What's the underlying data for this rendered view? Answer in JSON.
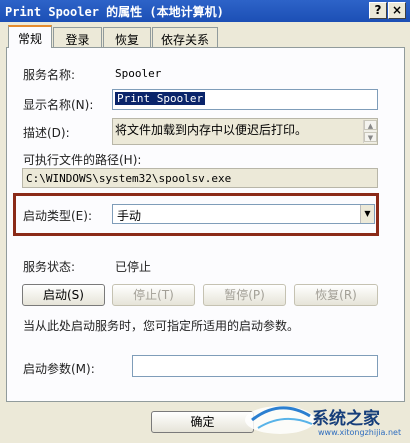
{
  "window": {
    "title": "Print Spooler 的属性 (本地计算机)",
    "help_button": "?",
    "close_button": "×"
  },
  "tabs": [
    {
      "label": "常规",
      "active": true
    },
    {
      "label": "登录",
      "active": false
    },
    {
      "label": "恢复",
      "active": false
    },
    {
      "label": "依存关系",
      "active": false
    }
  ],
  "general": {
    "service_name_label": "服务名称:",
    "service_name_value": "Spooler",
    "display_name_label": "显示名称(N):",
    "display_name_value": "Print Spooler",
    "description_label": "描述(D):",
    "description_value": "将文件加载到内存中以便迟后打印。",
    "path_label": "可执行文件的路径(H):",
    "path_value": "C:\\WINDOWS\\system32\\spoolsv.exe",
    "startup_type_label": "启动类型(E):",
    "startup_type_value": "手动",
    "status_label": "服务状态:",
    "status_value": "已停止",
    "buttons": {
      "start": "启动(S)",
      "stop": "停止(T)",
      "pause": "暂停(P)",
      "resume": "恢复(R)"
    },
    "hint_text": "当从此处启动服务时，您可指定所适用的启动参数。",
    "start_params_label": "启动参数(M):",
    "start_params_value": ""
  },
  "footer": {
    "ok_label": "确定"
  },
  "watermark": {
    "text": "系统之家",
    "url_text": "www.xitongzhijia.net"
  },
  "colors": {
    "titlebar": "#2160c4",
    "highlight_box": "#8b2a18",
    "selection": "#0a246a"
  }
}
